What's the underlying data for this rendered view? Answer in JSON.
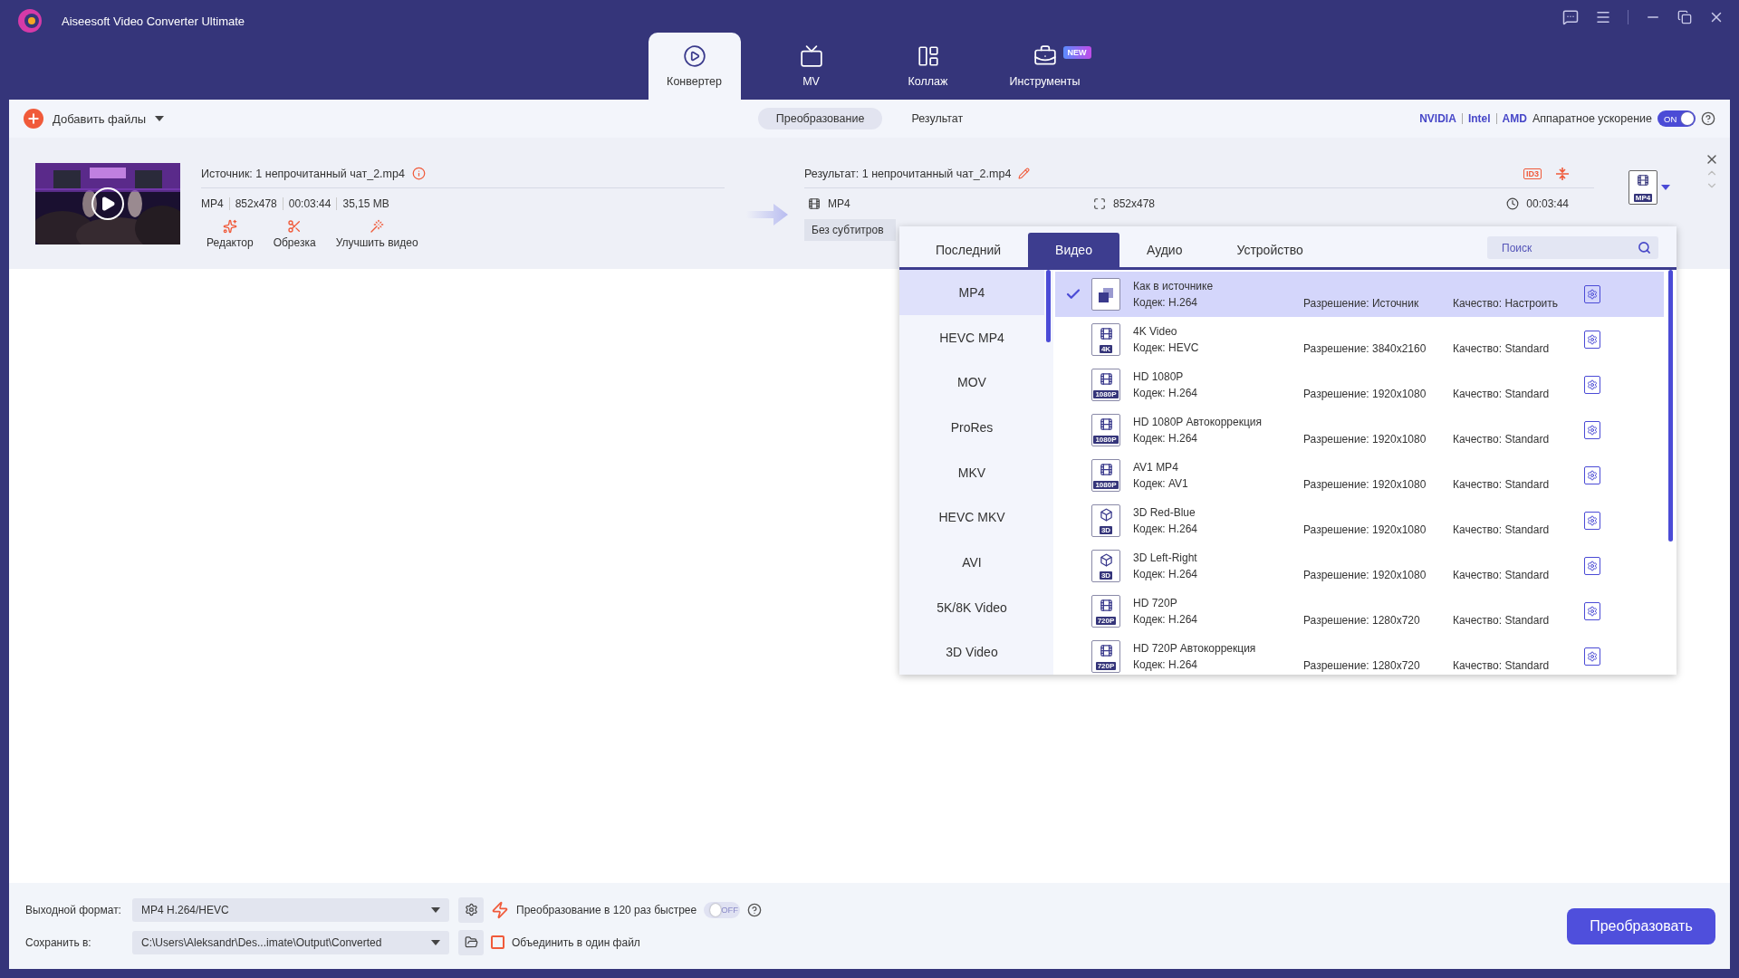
{
  "window": {
    "title": "Aiseesoft Video Converter Ultimate"
  },
  "nav_tabs": [
    {
      "label": "Конвертер",
      "selected": true,
      "kind": "converter"
    },
    {
      "label": "MV",
      "selected": false,
      "kind": "mv"
    },
    {
      "label": "Коллаж",
      "selected": false,
      "kind": "collage"
    },
    {
      "label": "Инструменты",
      "selected": false,
      "kind": "tools",
      "badge": "NEW"
    }
  ],
  "toolbar": {
    "add_files": "Добавить файлы",
    "view_tabs": [
      {
        "label": "Преобразование",
        "selected": true
      },
      {
        "label": "Результат",
        "selected": false
      }
    ],
    "vendors": [
      "NVIDIA",
      "Intel",
      "AMD"
    ],
    "hw_label": "Аппаратное ускорение",
    "hw_toggle": {
      "on": true,
      "text": "ON"
    }
  },
  "file": {
    "source": "Источник: 1 непрочитанный чат_2.mp4",
    "meta": [
      "MP4",
      "852x478",
      "00:03:44",
      "35,15 MB"
    ],
    "actions": [
      {
        "label": "Редактор",
        "kind": "editor"
      },
      {
        "label": "Обрезка",
        "kind": "cut"
      },
      {
        "label": "Улучшить видео",
        "kind": "enhance"
      }
    ],
    "result": "Результат: 1 непрочитанный чат_2.mp4",
    "id3": "ID3",
    "out_format": "MP4",
    "out_resolution": "852x478",
    "out_duration": "00:03:44",
    "subtitle": "Без субтитров",
    "format_badge": "MP4"
  },
  "popup": {
    "tabs": [
      {
        "label": "Последний",
        "selected": false
      },
      {
        "label": "Видео",
        "selected": true
      },
      {
        "label": "Аудио",
        "selected": false
      },
      {
        "label": "Устройство",
        "selected": false
      }
    ],
    "search": {
      "placeholder": "Поиск"
    },
    "categories": [
      {
        "label": "MP4",
        "selected": true
      },
      {
        "label": "HEVC MP4",
        "selected": false
      },
      {
        "label": "MOV",
        "selected": false
      },
      {
        "label": "ProRes",
        "selected": false
      },
      {
        "label": "MKV",
        "selected": false
      },
      {
        "label": "HEVC MKV",
        "selected": false
      },
      {
        "label": "AVI",
        "selected": false
      },
      {
        "label": "5K/8K Video",
        "selected": false
      },
      {
        "label": "3D Video",
        "selected": false
      }
    ],
    "presets": [
      {
        "kind": "source",
        "name": "Как в источнике",
        "codec": "Кодек: H.264",
        "resolution": "Разрешение: Источник",
        "quality": "Качество: Настроить",
        "selected": true
      },
      {
        "kind": "film",
        "badge": "4K",
        "name": "4K Video",
        "codec": "Кодек: HEVC",
        "resolution": "Разрешение: 3840x2160",
        "quality": "Качество: Standard",
        "selected": false
      },
      {
        "kind": "film",
        "badge": "1080P",
        "name": "HD 1080P",
        "codec": "Кодек: H.264",
        "resolution": "Разрешение: 1920x1080",
        "quality": "Качество: Standard",
        "selected": false
      },
      {
        "kind": "film",
        "badge": "1080P",
        "name": "HD 1080P Автокоррекция",
        "codec": "Кодек: H.264",
        "resolution": "Разрешение: 1920x1080",
        "quality": "Качество: Standard",
        "selected": false
      },
      {
        "kind": "film",
        "badge": "1080P",
        "name": "AV1 MP4",
        "codec": "Кодек: AV1",
        "resolution": "Разрешение: 1920x1080",
        "quality": "Качество: Standard",
        "selected": false
      },
      {
        "kind": "cube",
        "badge": "3D",
        "name": "3D Red-Blue",
        "codec": "Кодек: H.264",
        "resolution": "Разрешение: 1920x1080",
        "quality": "Качество: Standard",
        "selected": false
      },
      {
        "kind": "cube",
        "badge": "3D",
        "name": "3D Left-Right",
        "codec": "Кодек: H.264",
        "resolution": "Разрешение: 1920x1080",
        "quality": "Качество: Standard",
        "selected": false
      },
      {
        "kind": "film",
        "badge": "720P",
        "name": "HD 720P",
        "codec": "Кодек: H.264",
        "resolution": "Разрешение: 1280x720",
        "quality": "Качество: Standard",
        "selected": false
      },
      {
        "kind": "film",
        "badge": "720P",
        "name": "HD 720P Автокоррекция",
        "codec": "Кодек: H.264",
        "resolution": "Разрешение: 1280x720",
        "quality": "Качество: Standard",
        "selected": false
      }
    ]
  },
  "bottom": {
    "format_label": "Выходной формат:",
    "format_value": "MP4 H.264/HEVC",
    "save_label": "Сохранить в:",
    "save_value": "C:\\Users\\Aleksandr\\Des...imate\\Output\\Converted",
    "speed_label": "Преобразование в 120 раз быстрее",
    "speed_toggle": {
      "on": false,
      "text": "OFF"
    },
    "merge": {
      "label": "Объединить в один файл",
      "checked": false
    },
    "convert": "Преобразовать"
  }
}
